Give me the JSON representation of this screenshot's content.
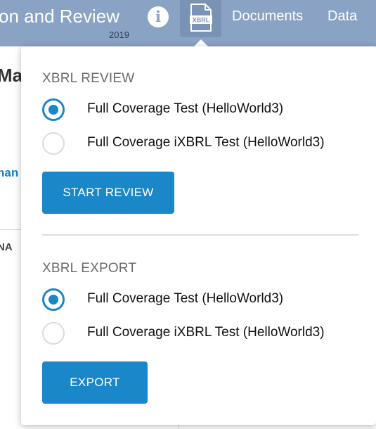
{
  "header": {
    "app_title": "on and Review",
    "year": "2019",
    "info_icon": "i",
    "xbrl_icon_label": "XBRL",
    "nav": {
      "documents": "Documents",
      "data": "Data"
    }
  },
  "background": {
    "heading": "Map",
    "link": "han",
    "column": "NA"
  },
  "dropdown": {
    "review": {
      "title": "XBRL REVIEW",
      "options": [
        {
          "label": "Full Coverage Test (HelloWorld3)",
          "selected": true
        },
        {
          "label": "Full Coverage iXBRL Test (HelloWorld3)",
          "selected": false
        }
      ],
      "button": "START REVIEW"
    },
    "export": {
      "title": "XBRL EXPORT",
      "options": [
        {
          "label": "Full Coverage Test (HelloWorld3)",
          "selected": true
        },
        {
          "label": "Full Coverage iXBRL Test (HelloWorld3)",
          "selected": false
        }
      ],
      "button": "EXPORT"
    }
  },
  "colors": {
    "header": "#8aa3c4",
    "accent": "#1a87c9",
    "link": "#1d7fc4"
  }
}
